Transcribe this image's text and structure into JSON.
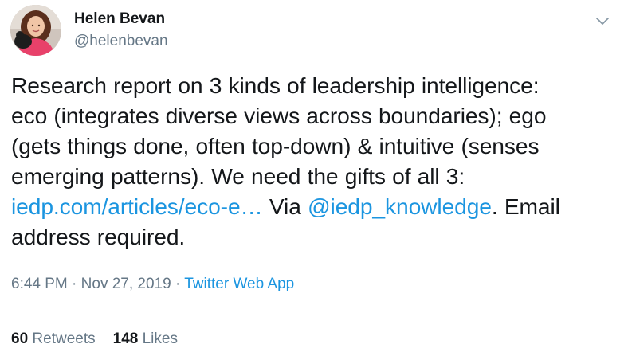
{
  "author": {
    "name": "Helen Bevan",
    "handle": "@helenbevan"
  },
  "tweet": {
    "lines": [
      "Research report on 3 kinds of leadership intelligence:",
      "eco (integrates diverse views across boundaries); ego",
      "(gets things done, often top-down) & intuitive (senses",
      "emerging patterns). We need the gifts of all 3:"
    ],
    "link_text": "iedp.com/articles/eco-e…",
    "via_text": " Via ",
    "mention": "@iedp_knowledge",
    "tail_text": ". Email",
    "last_line": "address required."
  },
  "meta": {
    "time": "6:44 PM",
    "separator_1": " · ",
    "date": "Nov 27, 2019",
    "separator_2": " · ",
    "source": "Twitter Web App"
  },
  "stats": {
    "retweets_count": "60",
    "retweets_label": "Retweets",
    "likes_count": "148",
    "likes_label": "Likes"
  },
  "icons": {
    "menu": "chevron-down-icon"
  },
  "colors": {
    "link": "#1b95e0",
    "secondary_text": "#657786",
    "primary_text": "#14171a",
    "divider": "#e6ecf0"
  }
}
